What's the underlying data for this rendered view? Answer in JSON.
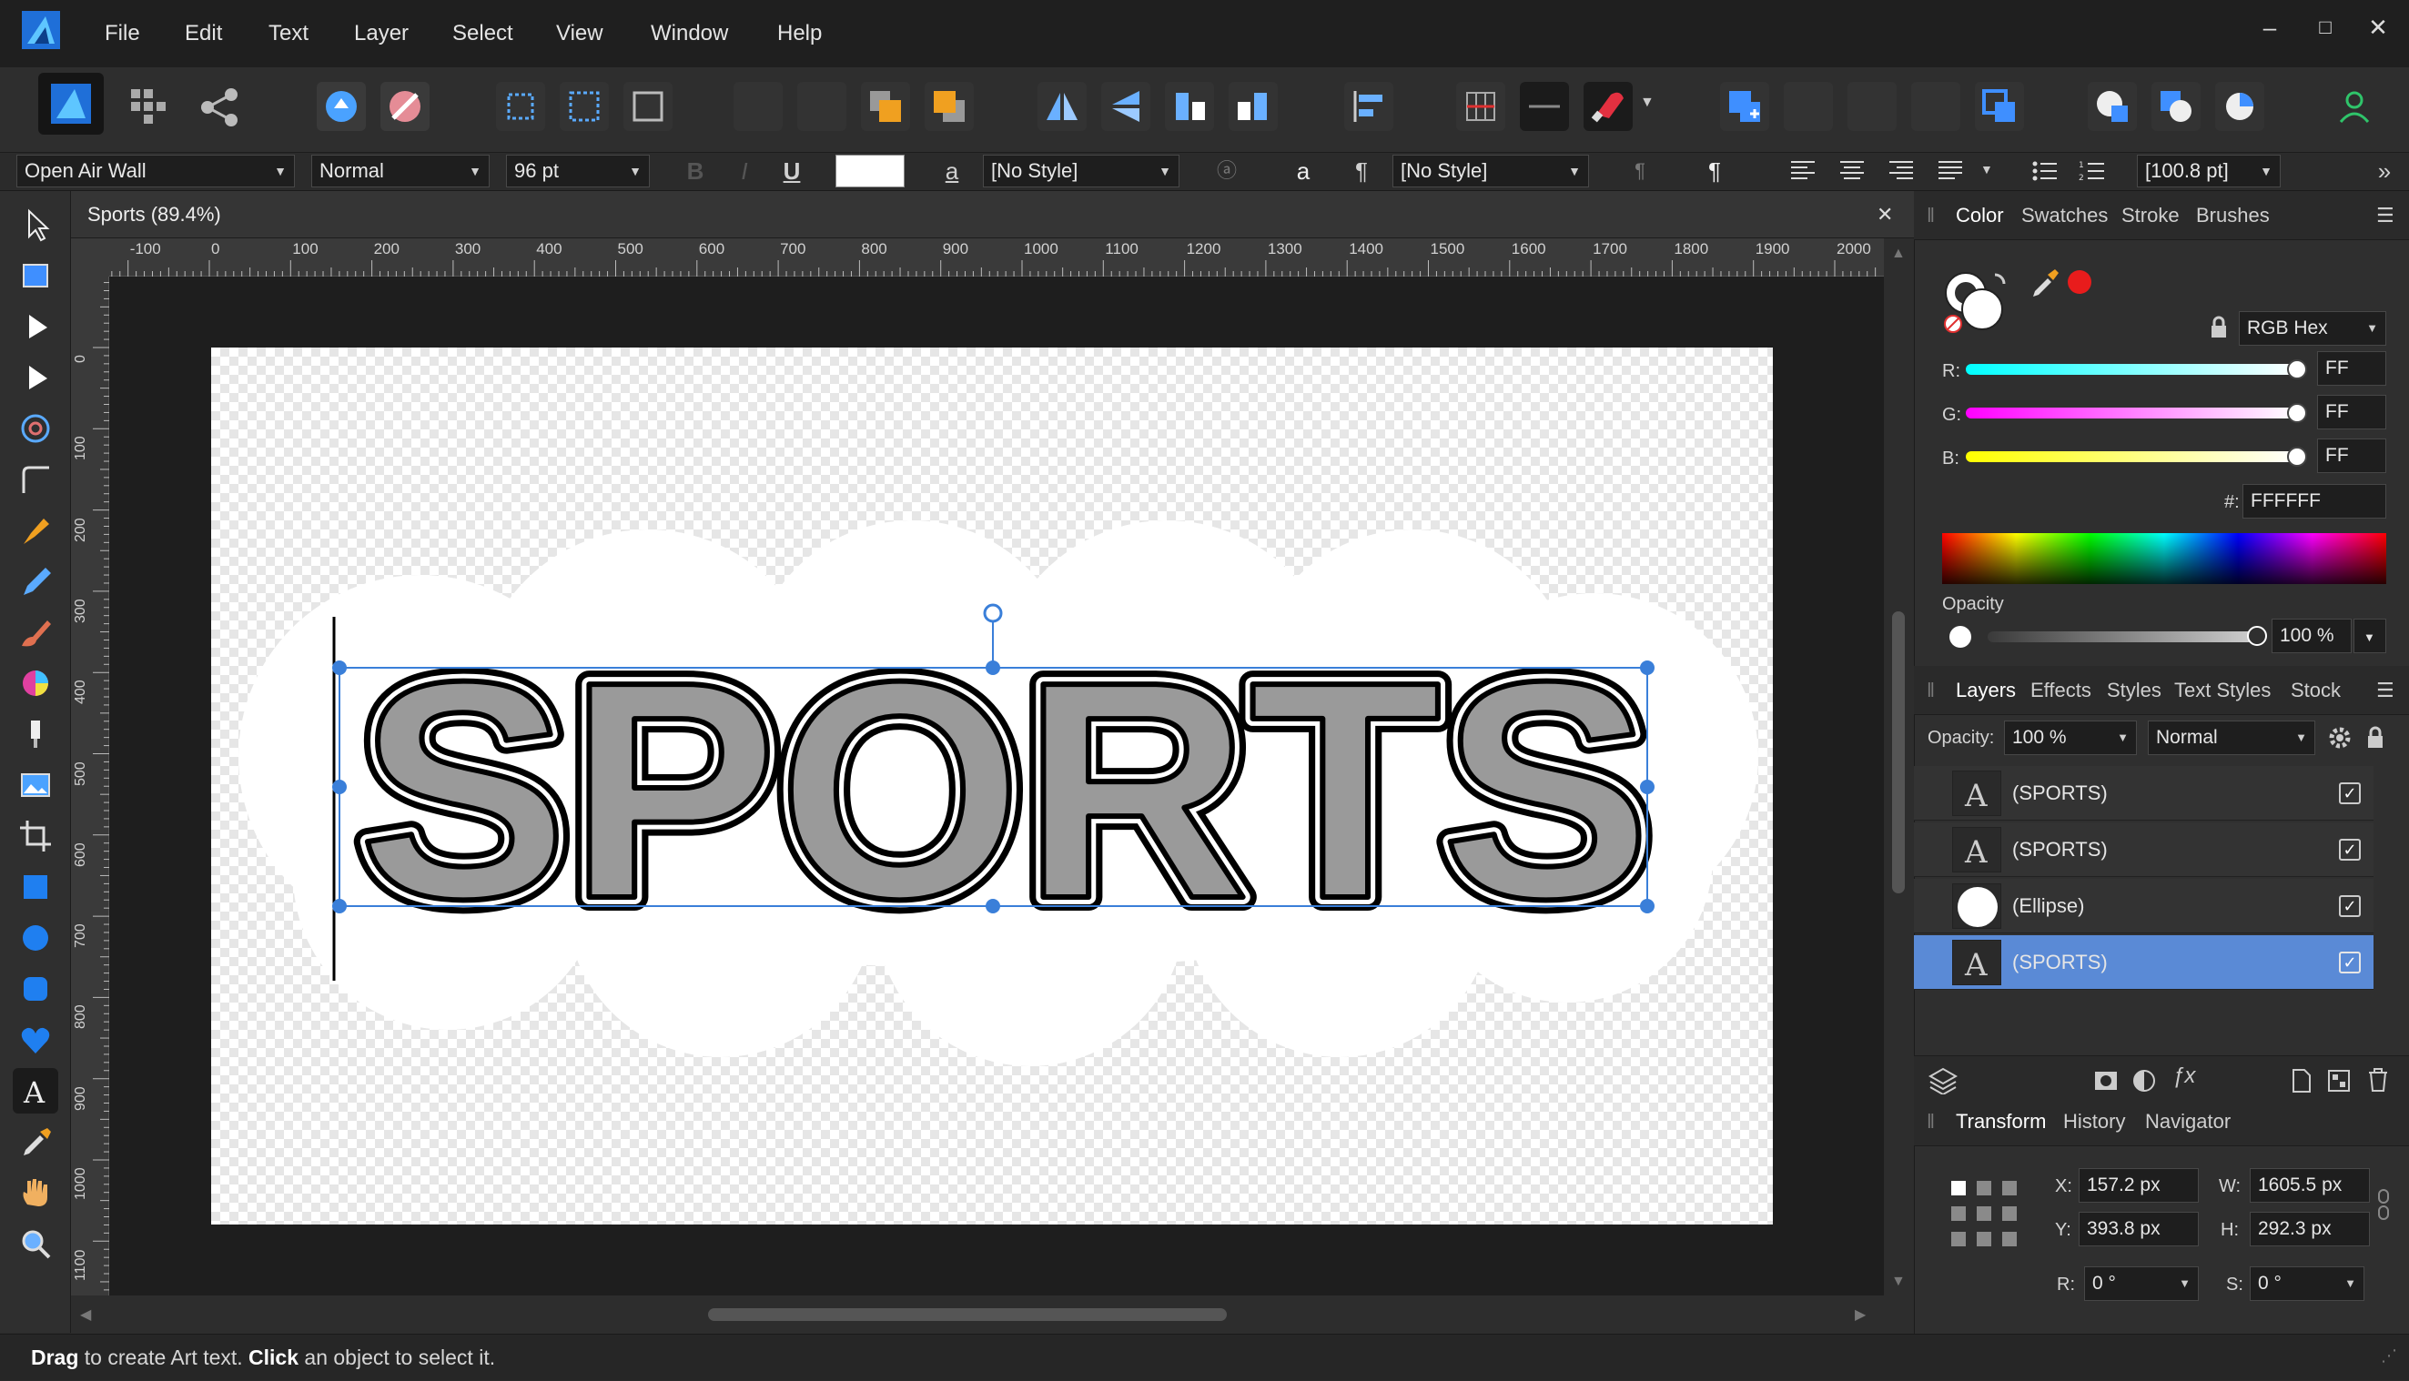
{
  "app": {
    "name": "Affinity Designer",
    "logo_icon": "affinity-designer-logo-icon"
  },
  "menu": [
    "File",
    "Edit",
    "Text",
    "Layer",
    "Select",
    "View",
    "Window",
    "Help"
  ],
  "window_controls": {
    "minimize": "–",
    "maximize": "□",
    "close": "✕"
  },
  "context_toolbar": {
    "font_family": "Open Air Wall",
    "font_style": "Normal",
    "font_size": "96 pt",
    "bold": "B",
    "italic": "I",
    "underline": "U",
    "char_style_glyph": "a",
    "char_style": "[No Style]",
    "para_style_glyph": "¶",
    "para_style": "[No Style]",
    "leading": "[100.8 pt]",
    "more": "»"
  },
  "document": {
    "tab_title": "Sports (89.4%)",
    "close": "✕",
    "text": "SPORTS",
    "ruler_unit": "px"
  },
  "ruler": {
    "h_labels": [
      "-100",
      "0",
      "100",
      "200",
      "300",
      "400",
      "500",
      "600",
      "700",
      "800",
      "900",
      "1000",
      "1100",
      "1200",
      "1300",
      "1400",
      "1500",
      "1600",
      "1700",
      "1800",
      "1900",
      "2000"
    ],
    "v_labels": [
      "0",
      "100",
      "200",
      "300",
      "400",
      "500",
      "600",
      "700",
      "800",
      "900",
      "1000",
      "1100"
    ]
  },
  "status": {
    "drag": "Drag",
    "drag_text": " to create Art text. ",
    "click": "Click",
    "click_text": " an object to select it."
  },
  "color_panel": {
    "tabs": [
      "Color",
      "Swatches",
      "Stroke",
      "Brushes"
    ],
    "mode": "RGB Hex",
    "r_label": "R:",
    "g_label": "G:",
    "b_label": "B:",
    "r_value": "FF",
    "g_value": "FF",
    "b_value": "FF",
    "r_level": 1.0,
    "g_level": 1.0,
    "b_level": 1.0,
    "hex_label": "#:",
    "hex_value": "FFFFFF",
    "opacity_label": "Opacity",
    "opacity_value": "100 %",
    "accent_color": "#e81c1c"
  },
  "layers_panel": {
    "tabs": [
      "Layers",
      "Effects",
      "Styles",
      "Text Styles",
      "Stock"
    ],
    "opacity_label": "Opacity:",
    "opacity_value": "100 %",
    "blend_mode": "Normal",
    "layers": [
      {
        "name": "(SPORTS)",
        "type": "text",
        "selected": false
      },
      {
        "name": "(SPORTS)",
        "type": "text",
        "selected": false
      },
      {
        "name": "(Ellipse)",
        "type": "ellipse",
        "selected": false
      },
      {
        "name": "(SPORTS)",
        "type": "text",
        "selected": true
      }
    ]
  },
  "transform_panel": {
    "tabs": [
      "Transform",
      "History",
      "Navigator"
    ],
    "x_label": "X:",
    "x_value": "157.2 px",
    "y_label": "Y:",
    "y_value": "393.8 px",
    "w_label": "W:",
    "w_value": "1605.5 px",
    "h_label": "H:",
    "h_value": "292.3 px",
    "r_label": "R:",
    "r_value": "0 °",
    "s_label": "S:",
    "s_value": "0 °"
  },
  "colors": {
    "selection": "#3a7fd9",
    "layer_selected": "#5a8ad6",
    "panel_bg": "#2f2f2f"
  }
}
